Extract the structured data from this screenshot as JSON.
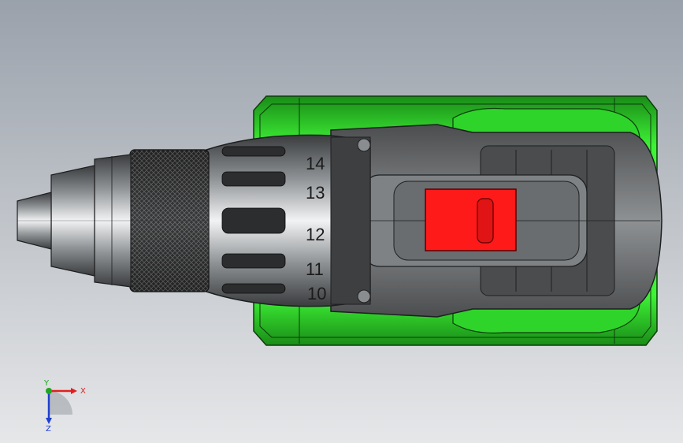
{
  "viewport": {
    "background_top": "#9aa1ab",
    "background_bottom": "#e6e7e9"
  },
  "model": {
    "body_color": "#2fe02a",
    "body_dark": "#1a8c17",
    "button_color": "#ff1a1a",
    "metal_color": "#b9bcbf",
    "torque_scale": [
      "14",
      "13",
      "12",
      "11",
      "10"
    ]
  },
  "triad": {
    "x_label": "X",
    "y_label": "Y",
    "z_label": "Z",
    "x_color": "#e02020",
    "y_color": "#1fa61f",
    "z_color": "#2040d0"
  }
}
